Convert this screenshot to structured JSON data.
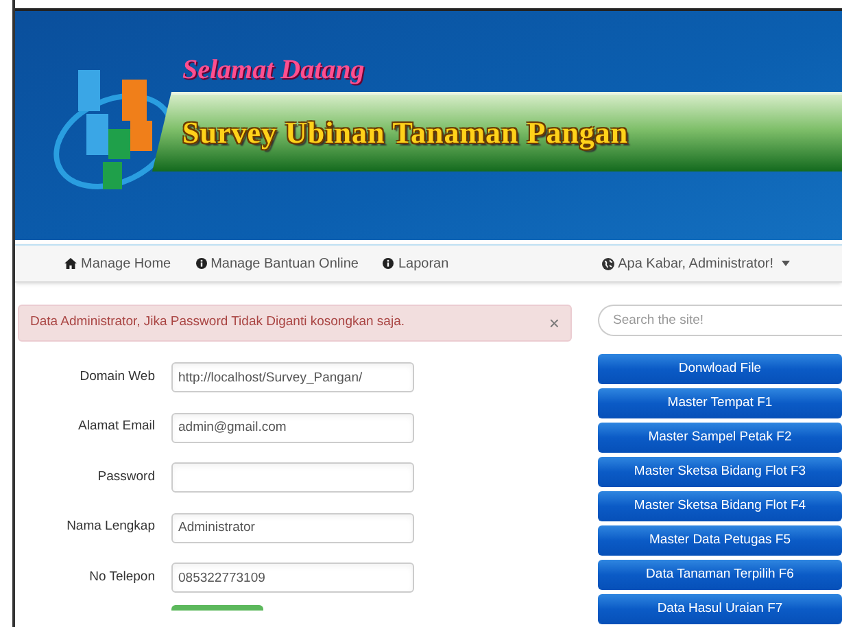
{
  "banner": {
    "greeting": "Selamat Datang",
    "title": "Survey Ubinan Tanaman Pangan"
  },
  "navbar": {
    "items": [
      {
        "label": "Manage Home"
      },
      {
        "label": "Manage Bantuan Online"
      },
      {
        "label": "Laporan"
      }
    ],
    "user_menu": {
      "label": "Apa Kabar, Administrator!"
    }
  },
  "alert": {
    "message": "Data Administrator, Jika Password Tidak Diganti kosongkan saja.",
    "close": "×"
  },
  "form": {
    "fields": [
      {
        "label": "Domain Web",
        "value": "http://localhost/Survey_Pangan/"
      },
      {
        "label": "Alamat Email",
        "value": "admin@gmail.com"
      },
      {
        "label": "Password"
      },
      {
        "label": "Nama Lengkap",
        "value": "Administrator"
      },
      {
        "label": "No Telepon",
        "value": "085322773109"
      }
    ]
  },
  "sidebar": {
    "search": {
      "placeholder": "Search the site!"
    },
    "buttons": [
      "Donwload File",
      "Master Tempat F1",
      "Master Sampel Petak F2",
      "Master Sketsa Bidang Flot F3",
      "Master Sketsa Bidang Flot F4",
      "Master Data Petugas F5",
      "Data Tanaman Terpilih F6",
      "Data Hasul Uraian F7"
    ]
  }
}
